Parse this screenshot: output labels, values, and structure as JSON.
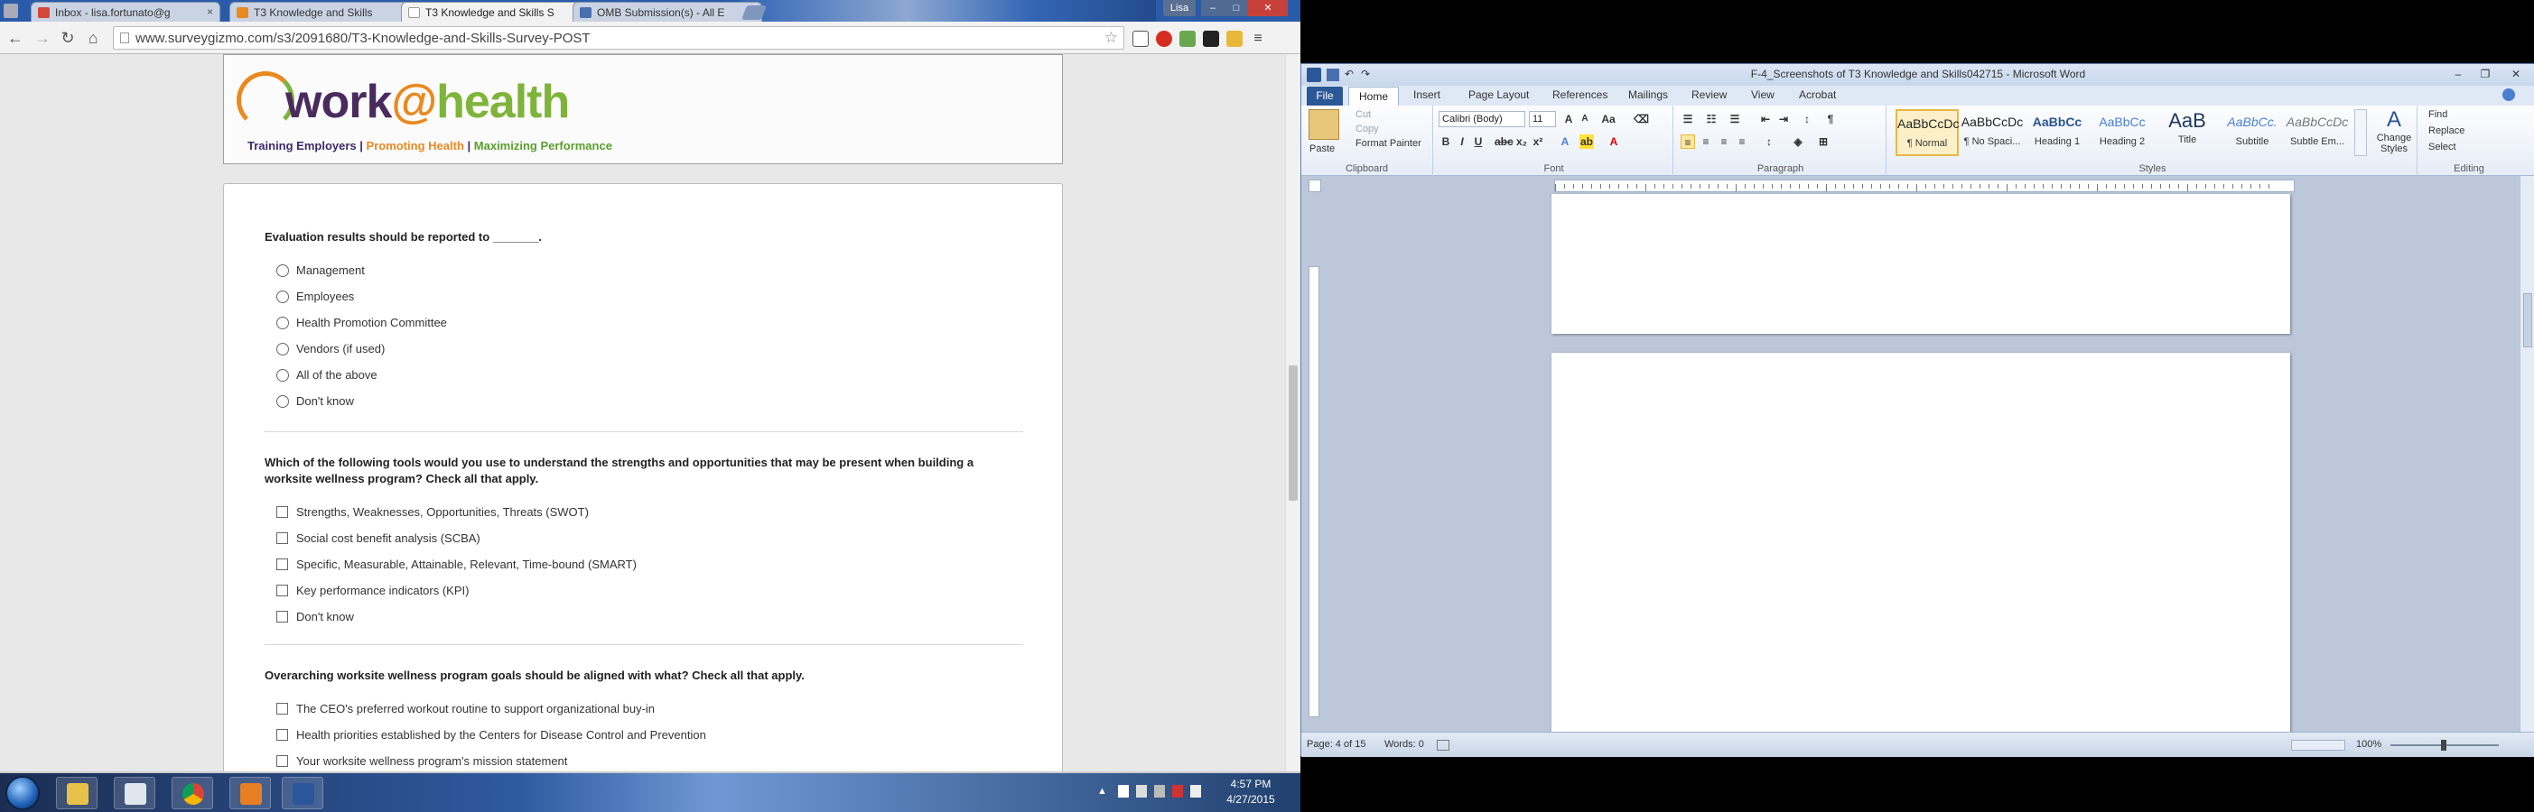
{
  "browser": {
    "tabs": [
      {
        "label": "Inbox - lisa.fortunato@g",
        "color": "#d44638"
      },
      {
        "label": "T3 Knowledge and Skills",
        "color": "#e9891f"
      },
      {
        "label": "T3 Knowledge and Skills S",
        "color": "#7a8aa0"
      },
      {
        "label": "OMB Submission(s) - All E",
        "color": "#4a6fb0"
      }
    ],
    "user": "Lisa",
    "url": "www.surveygizmo.com/s3/2091680/T3-Knowledge-and-Skills-Survey-POST"
  },
  "header": {
    "logo_work": "work",
    "logo_at": "@",
    "logo_health": "health",
    "tagline1": "Training Employers",
    "sep": "|",
    "tagline2": "Promoting Health",
    "tagline3": "Maximizing Performance"
  },
  "survey": {
    "q1": {
      "title": "Evaluation results should be reported to _______.",
      "options": [
        "Management",
        "Employees",
        "Health Promotion Committee",
        "Vendors (if used)",
        "All of the above",
        "Don't know"
      ]
    },
    "q2": {
      "title": "Which of the following tools would you use to understand the strengths and opportunities that may be present when building a worksite wellness program?  Check all that apply.",
      "options": [
        "Strengths, Weaknesses, Opportunities, Threats (SWOT)",
        "Social cost benefit analysis (SCBA)",
        "Specific, Measurable, Attainable, Relevant, Time-bound (SMART)",
        "Key performance indicators (KPI)",
        "Don't know"
      ]
    },
    "q3": {
      "title": "Overarching worksite wellness program goals should be aligned with what?  Check all that apply.",
      "options": [
        "The CEO's preferred workout routine to support organizational buy-in",
        "Health priorities established by the Centers for Disease Control and Prevention",
        "Your worksite wellness program's mission statement"
      ]
    }
  },
  "taskbar": {
    "time": "4:57 PM",
    "date": "4/27/2015"
  },
  "word": {
    "title": "F-4_Screenshots of T3 Knowledge and Skills042715 - Microsoft Word",
    "tabs": [
      "File",
      "Home",
      "Insert",
      "Page Layout",
      "References",
      "Mailings",
      "Review",
      "View",
      "Acrobat"
    ],
    "clipboard": {
      "paste": "Paste",
      "cut": "Cut",
      "copy": "Copy",
      "format_painter": "Format Painter",
      "label": "Clipboard"
    },
    "font": {
      "name": "Calibri (Body)",
      "size": "11",
      "label": "Font"
    },
    "paragraph_label": "Paragraph",
    "styles": [
      {
        "preview": "AaBbCcDc",
        "name": "¶ Normal"
      },
      {
        "preview": "AaBbCcDc",
        "name": "¶ No Spaci..."
      },
      {
        "preview": "AaBbCc",
        "name": "Heading 1"
      },
      {
        "preview": "AaBbCc",
        "name": "Heading 2"
      },
      {
        "preview": "AaB",
        "name": "Title"
      },
      {
        "preview": "AaBbCc.",
        "name": "Subtitle"
      },
      {
        "preview": "AaBbCcDc",
        "name": "Subtle Em..."
      }
    ],
    "styles_label": "Styles",
    "change_styles": "Change Styles",
    "editing": {
      "find": "Find",
      "replace": "Replace",
      "select": "Select",
      "label": "Editing"
    },
    "status": {
      "page": "Page: 4 of 15",
      "words": "Words: 0",
      "zoom": "100%"
    }
  }
}
